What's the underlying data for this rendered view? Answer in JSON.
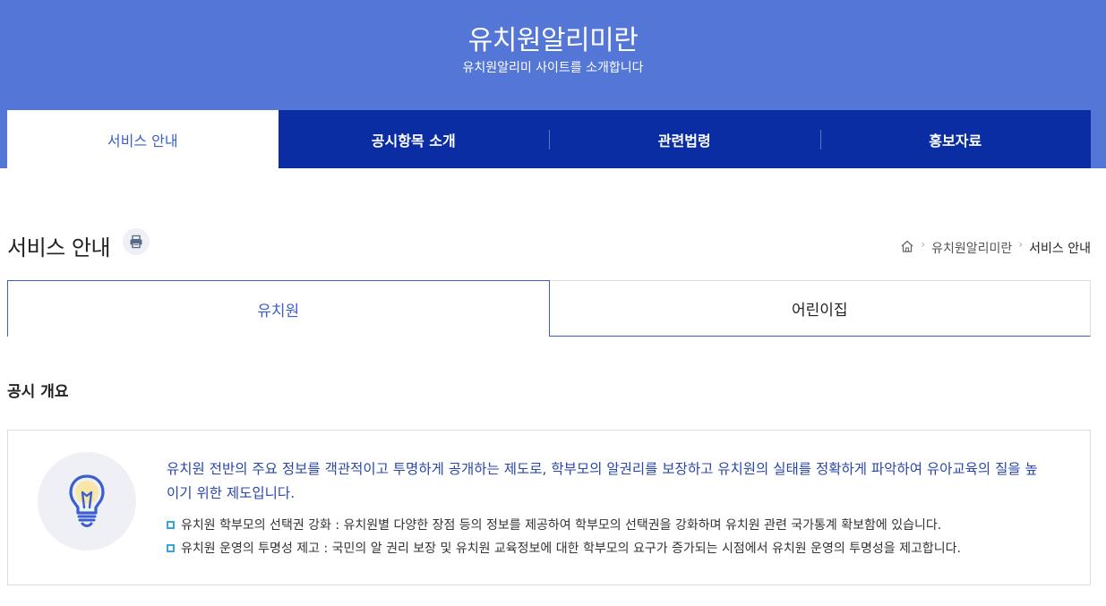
{
  "hero": {
    "title": "유치원알리미란",
    "subtitle": "유치원알리미 사이트를 소개합니다"
  },
  "gnb": [
    {
      "label": "서비스 안내",
      "active": true
    },
    {
      "label": "공시항목 소개",
      "active": false
    },
    {
      "label": "관련법령",
      "active": false
    },
    {
      "label": "홍보자료",
      "active": false
    }
  ],
  "page": {
    "title": "서비스 안내",
    "print_icon": "print-icon"
  },
  "breadcrumb": {
    "home_icon": "home-icon",
    "items": [
      "유치원알리미란",
      "서비스 안내"
    ]
  },
  "tabs": [
    {
      "label": "유치원",
      "active": true
    },
    {
      "label": "어린이집",
      "active": false
    }
  ],
  "section": {
    "title": "공시 개요",
    "icon": "lightbulb-icon",
    "lead": "유치원 전반의 주요 정보를 객관적이고 투명하게 공개하는 제도로, 학부모의 알권리를 보장하고 유치원의 실태를 정확하게 파악하여 유아교육의 질을 높이기 위한 제도입니다.",
    "bullets": [
      "유치원 학부모의 선택권 강화 : 유치원별 다양한 장점 등의 정보를 제공하여 학부모의 선택권을 강화하며 유치원 관련 국가통계 확보함에 있습니다.",
      "유치원 운영의 투명성 제고 : 국민의 알 권리 보장 및 유치원 교육정보에 대한 학부모의 요구가 증가되는 시점에서 유치원 운영의 투명성을 제고합니다."
    ]
  },
  "colors": {
    "hero_bg": "#5476d6",
    "gnb_bg": "#0a2da3",
    "accent": "#3a5fc8",
    "bullet_square": "#35a4e0"
  }
}
